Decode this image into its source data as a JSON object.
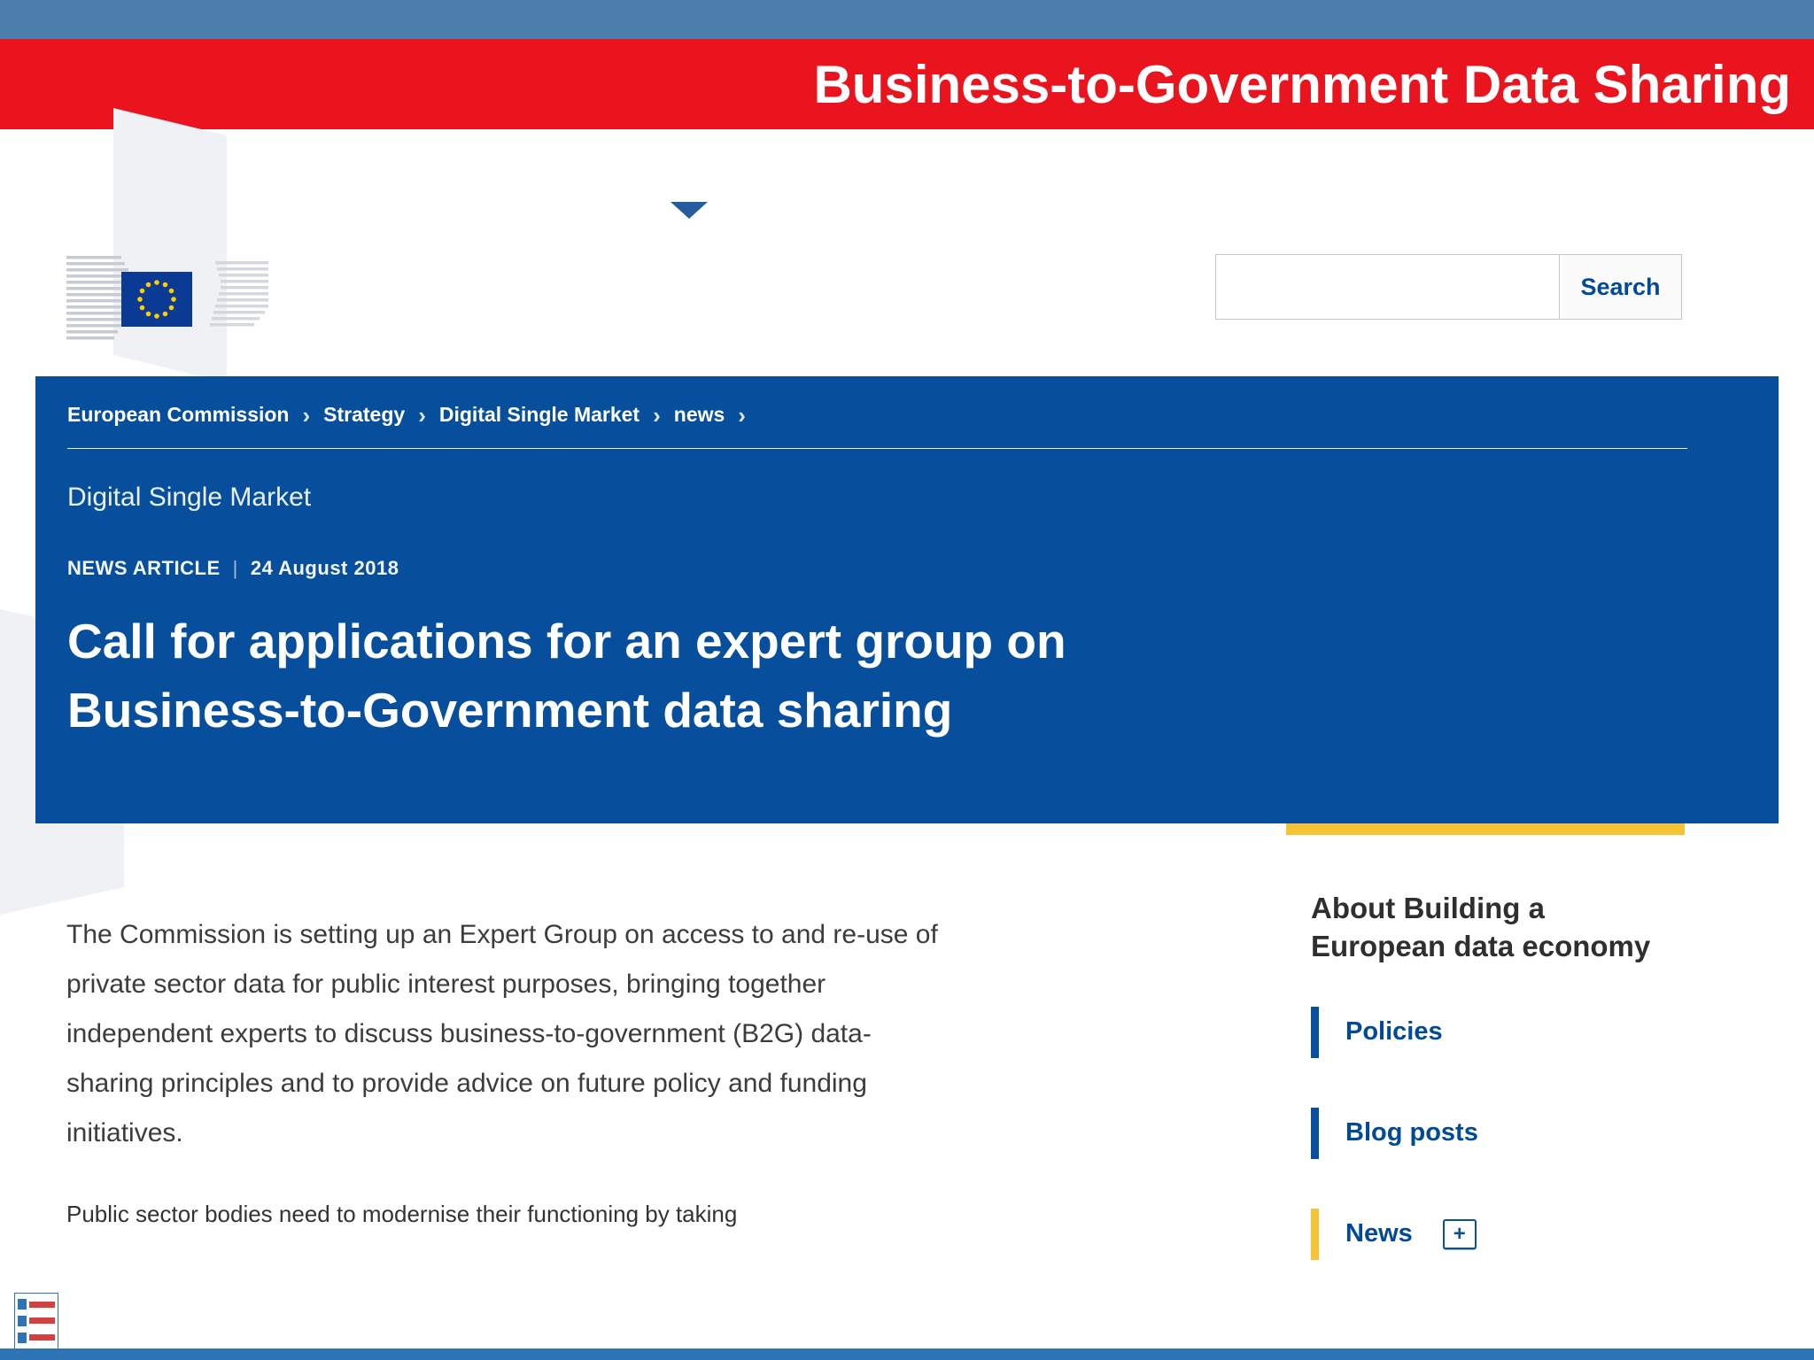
{
  "slide": {
    "banner_title": "Business-to-Government Data Sharing"
  },
  "header": {
    "search_value": "",
    "search_button": "Search"
  },
  "breadcrumb": {
    "separator": "›",
    "items": [
      "European Commission",
      "Strategy",
      "Digital Single Market",
      "news"
    ]
  },
  "article": {
    "section_title": "Digital Single Market",
    "kicker": "NEWS ARTICLE",
    "kicker_separator": "|",
    "date": "24 August 2018",
    "title": "Call for applications for an expert group on Business-to-Government data sharing",
    "body": "The Commission is setting up an Expert Group on access to and re-use of private sector data for public interest purposes, bringing together independent experts to discuss business-to-government (B2G) data-sharing principles and to provide advice on future policy and funding initiatives.",
    "body_more": "Public sector bodies need to modernise their functioning by taking"
  },
  "sidebar": {
    "heading": "About Building a European data economy",
    "items": [
      {
        "label": "Policies"
      },
      {
        "label": "Blog posts"
      },
      {
        "label": "News",
        "plus": "+"
      }
    ]
  },
  "colors": {
    "top_bar_blue": "#4a7dab",
    "bottom_bar_blue": "#2e74b5",
    "banner_red": "#e9141d",
    "hero_blue": "#074f9d",
    "accent_yellow": "#f5c333",
    "link_blue": "#004a99",
    "eu_flag_blue": "#003399",
    "eu_star_yellow": "#ffcc00"
  }
}
